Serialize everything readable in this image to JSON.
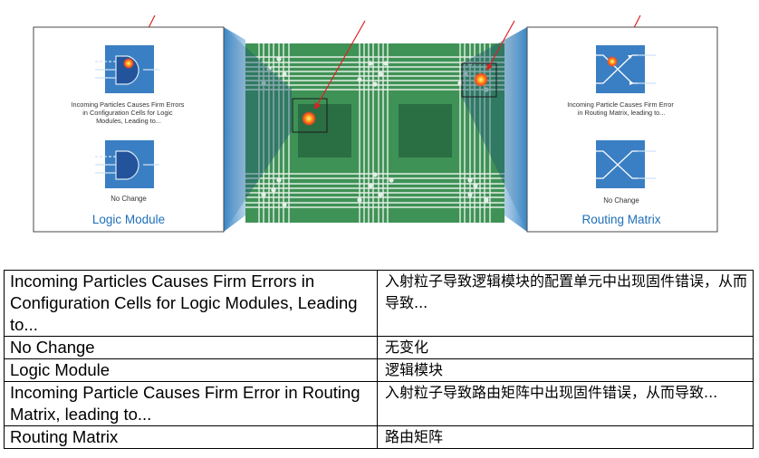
{
  "diagram": {
    "left_panel": {
      "title": "Logic Module",
      "top_caption": [
        "Incoming Particles Causes Firm Errors",
        "in Configuration Cells for Logic",
        "Modules, Leading to..."
      ],
      "bottom_caption": "No Change",
      "top_icon": "and-gate-with-particle-hit-icon",
      "bottom_icon": "and-gate-icon"
    },
    "right_panel": {
      "title": "Routing Matrix",
      "top_caption": [
        "Incoming Particle Causes Firm Error",
        "in Routing Matrix, leading to..."
      ],
      "bottom_caption": "No Change",
      "top_icon": "crossbar-switch-with-particle-hit-icon",
      "bottom_icon": "crossbar-switch-icon"
    },
    "center": {
      "label": "fpga-chip-grid",
      "callouts": [
        "logic-module-zoom-box",
        "routing-matrix-zoom-box"
      ]
    },
    "colors": {
      "chip_green": "#3f9256",
      "chip_dark_green": "#2a6e43",
      "panel_blue": "#3a7fc3",
      "gate_dark_blue": "#23539a",
      "title_blue": "#1e6fb8",
      "arrow_red": "#e02020",
      "trace_white": "#e4efe6"
    }
  },
  "table": {
    "rows": [
      {
        "en": "Incoming Particles Causes Firm Errors in Configuration Cells for Logic Modules, Leading to...",
        "zh": "入射粒子导致逻辑模块的配置单元中出现固件错误，从而导致..."
      },
      {
        "en": "No Change",
        "zh": "无变化"
      },
      {
        "en": "Logic Module",
        "zh": "逻辑模块"
      },
      {
        "en": "Incoming Particle Causes Firm Error in Routing Matrix, leading to...",
        "zh": "入射粒子导致路由矩阵中出现固件错误，从而导致..."
      },
      {
        "en": "Routing Matrix",
        "zh": "路由矩阵"
      }
    ]
  }
}
